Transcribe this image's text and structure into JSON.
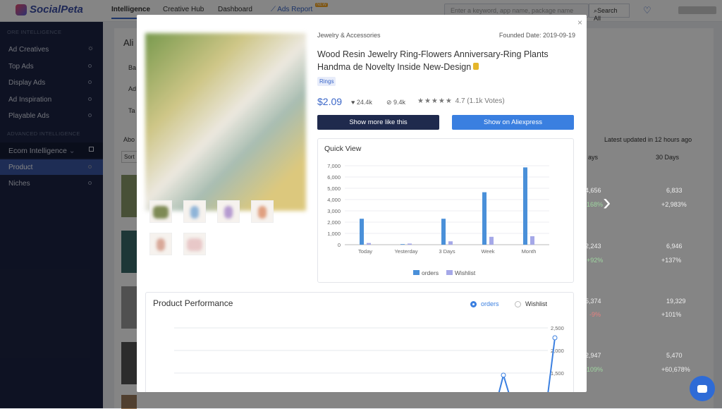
{
  "app": {
    "logo": "SocialPeta"
  },
  "topnav": {
    "items": [
      "Intelligence",
      "Creative Hub",
      "Dashboard"
    ],
    "ads_report": "Ads Report",
    "new_badge": "NEW",
    "search_placeholder": "Enter a keyword, app name, package name",
    "search_all": "Search All"
  },
  "sidebar": {
    "section1": "ORE INTELLIGENCE",
    "items1": [
      "Ad Creatives",
      "Top Ads",
      "Display Ads",
      "Ad Inspiration",
      "Playable Ads"
    ],
    "section2": "ADVANCED INTELLIGENCE",
    "group": "Ecom Intelligence",
    "items2": [
      "Product",
      "Niches"
    ]
  },
  "background": {
    "page_title_fragment": "Ali",
    "row_labels": [
      "Ba",
      "Ad",
      "Ta"
    ],
    "about_fragment": "Abo",
    "sort_fragment": "Sort",
    "updated": "Latest updated in 12 hours ago",
    "col_days_fragment": "ays",
    "col_30": "30 Days",
    "rows": [
      {
        "a": "4,656",
        "a_pct": "168%",
        "b": "6,833",
        "b_pct": "+2,983%"
      },
      {
        "a": "2,243",
        "a_pct": "+92%",
        "b": "6,946",
        "b_pct": "+137%"
      },
      {
        "a": "5,374",
        "a_pct": "-9%",
        "b": "19,329",
        "b_pct": "+101%"
      },
      {
        "a": "2,947",
        "a_pct": "109%",
        "b": "5,470",
        "b_pct": "+60,678%"
      }
    ]
  },
  "modal": {
    "category": "Jewelry & Accessories",
    "founded": "Founded Date: 2019-09-19",
    "title": "Wood Resin Jewelry Ring-Flowers Anniversary-Ring Plants Handma de Novelty Inside New-Design",
    "tag": "Rings",
    "price": "$2.09",
    "likes": "24.4k",
    "tags_count": "9.4k",
    "rating_text": "4.7 (1.1k Votes)",
    "rating": 4.7,
    "btn_more": "Show more like this",
    "btn_ali": "Show on Aliexpress",
    "quick_view_title": "Quick View",
    "performance_title": "Product Performance",
    "radio_orders": "orders",
    "radio_wishlist": "Wishlist",
    "colors": {
      "accent": "#3a7fe0",
      "dark": "#1f2a4d",
      "orders": "#4a90d9",
      "wishlist": "#a5a8e8"
    }
  },
  "chart_data": [
    {
      "type": "bar",
      "title": "Quick View",
      "categories": [
        "Today",
        "Yesterday",
        "3 Days",
        "Week",
        "Month"
      ],
      "series": [
        {
          "name": "orders",
          "values": [
            2300,
            50,
            2300,
            4650,
            6850
          ]
        },
        {
          "name": "Wishlist",
          "values": [
            150,
            100,
            300,
            700,
            750
          ]
        }
      ],
      "ylim": [
        0,
        7000
      ],
      "yticks": [
        0,
        1000,
        2000,
        3000,
        4000,
        5000,
        6000,
        7000
      ],
      "legend": "bottom",
      "grid": true
    },
    {
      "type": "line",
      "title": "Product Performance",
      "series": [
        {
          "name": "orders"
        }
      ],
      "yticks": [
        1500,
        2000,
        2500
      ],
      "legend": "top-right",
      "grid": true
    }
  ]
}
